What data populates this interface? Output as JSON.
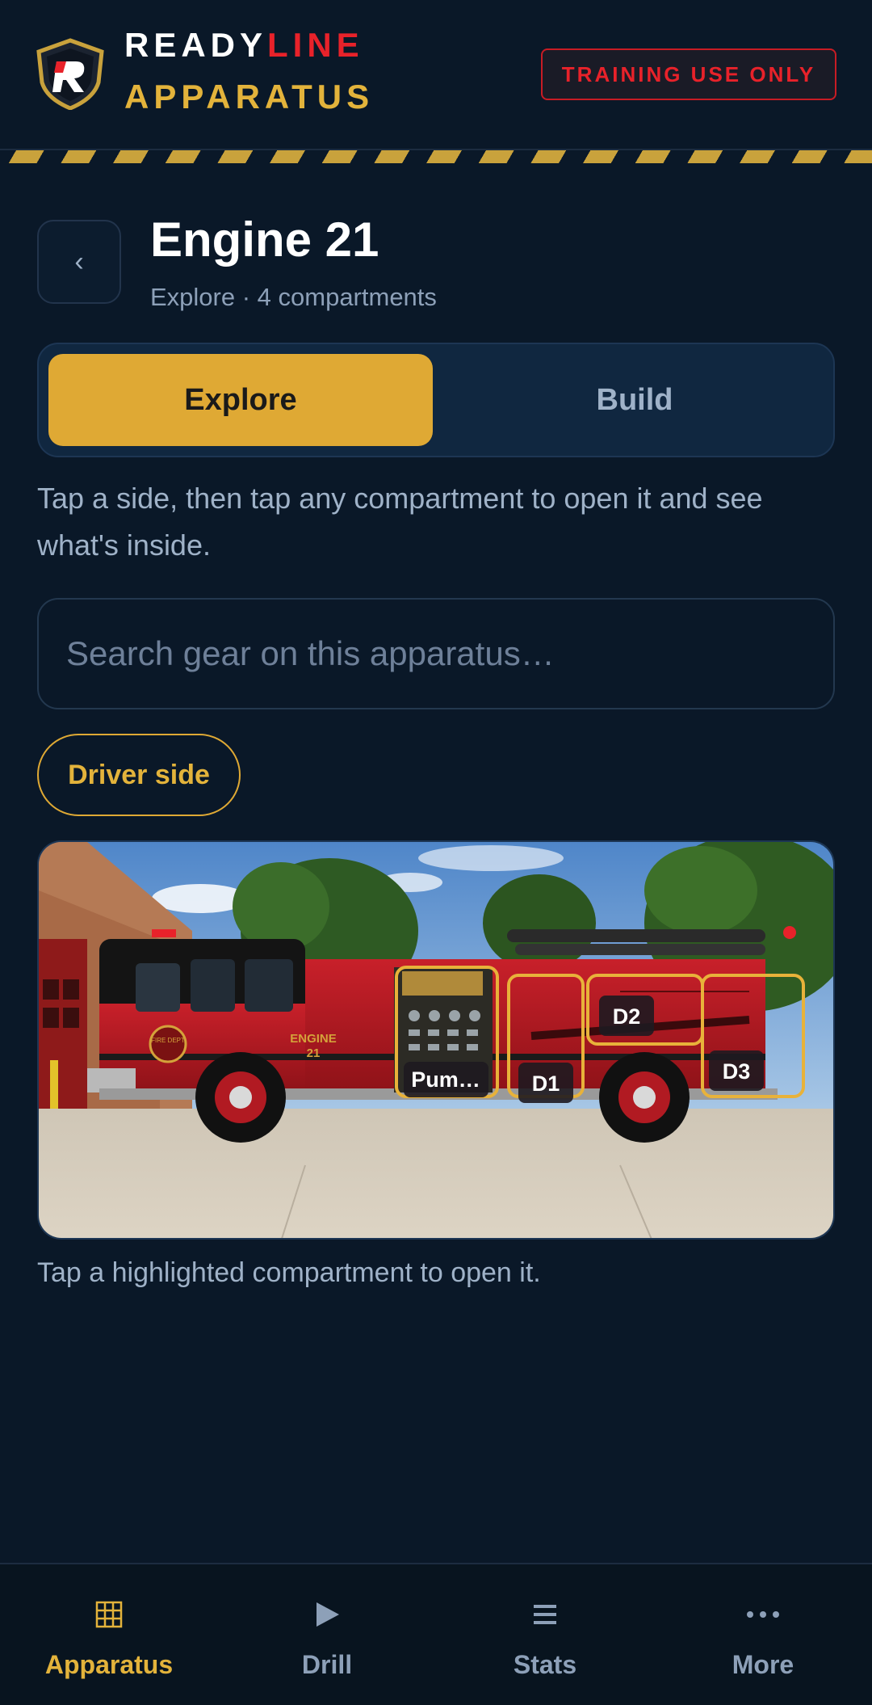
{
  "header": {
    "brand_part1": "READY",
    "brand_part2": "LINE",
    "brand_line2": "APPARATUS",
    "training_badge": "TRAINING USE ONLY",
    "logo_icon": "shield-r-logo"
  },
  "page": {
    "title": "Engine 21",
    "subtitle": "Explore · 4 compartments",
    "back_icon": "chevron-left-icon",
    "back_glyph": "‹"
  },
  "mode_toggle": {
    "explore_label": "Explore",
    "build_label": "Build",
    "selected": "Explore"
  },
  "instructions": "Tap a side, then tap any compartment to open it and see what's inside.",
  "search": {
    "placeholder": "Search gear on this apparatus…",
    "value": ""
  },
  "side_selector": {
    "label": "Driver side"
  },
  "truck_image": {
    "unit_lettering": "ENGINE",
    "unit_number": "21",
    "dept_seal": "FIRE DEPT",
    "compartments": [
      {
        "id": "pump",
        "label": "Pum…"
      },
      {
        "id": "d1",
        "label": "D1"
      },
      {
        "id": "d2",
        "label": "D2"
      },
      {
        "id": "d3",
        "label": "D3"
      }
    ]
  },
  "hint": "Tap a highlighted compartment to open it.",
  "bottom_nav": {
    "items": [
      {
        "label": "Apparatus",
        "icon": "grid-icon",
        "glyph": "▦",
        "active": true
      },
      {
        "label": "Drill",
        "icon": "play-icon",
        "glyph": "▶",
        "active": false
      },
      {
        "label": "Stats",
        "icon": "menu-lines-icon",
        "glyph": "≡",
        "active": false
      },
      {
        "label": "More",
        "icon": "more-dots-icon",
        "glyph": "···",
        "active": false
      }
    ]
  },
  "colors": {
    "background": "#0a1828",
    "accent_gold": "#dfa934",
    "brand_red": "#e8222a",
    "muted_text": "#9fb2c8"
  }
}
